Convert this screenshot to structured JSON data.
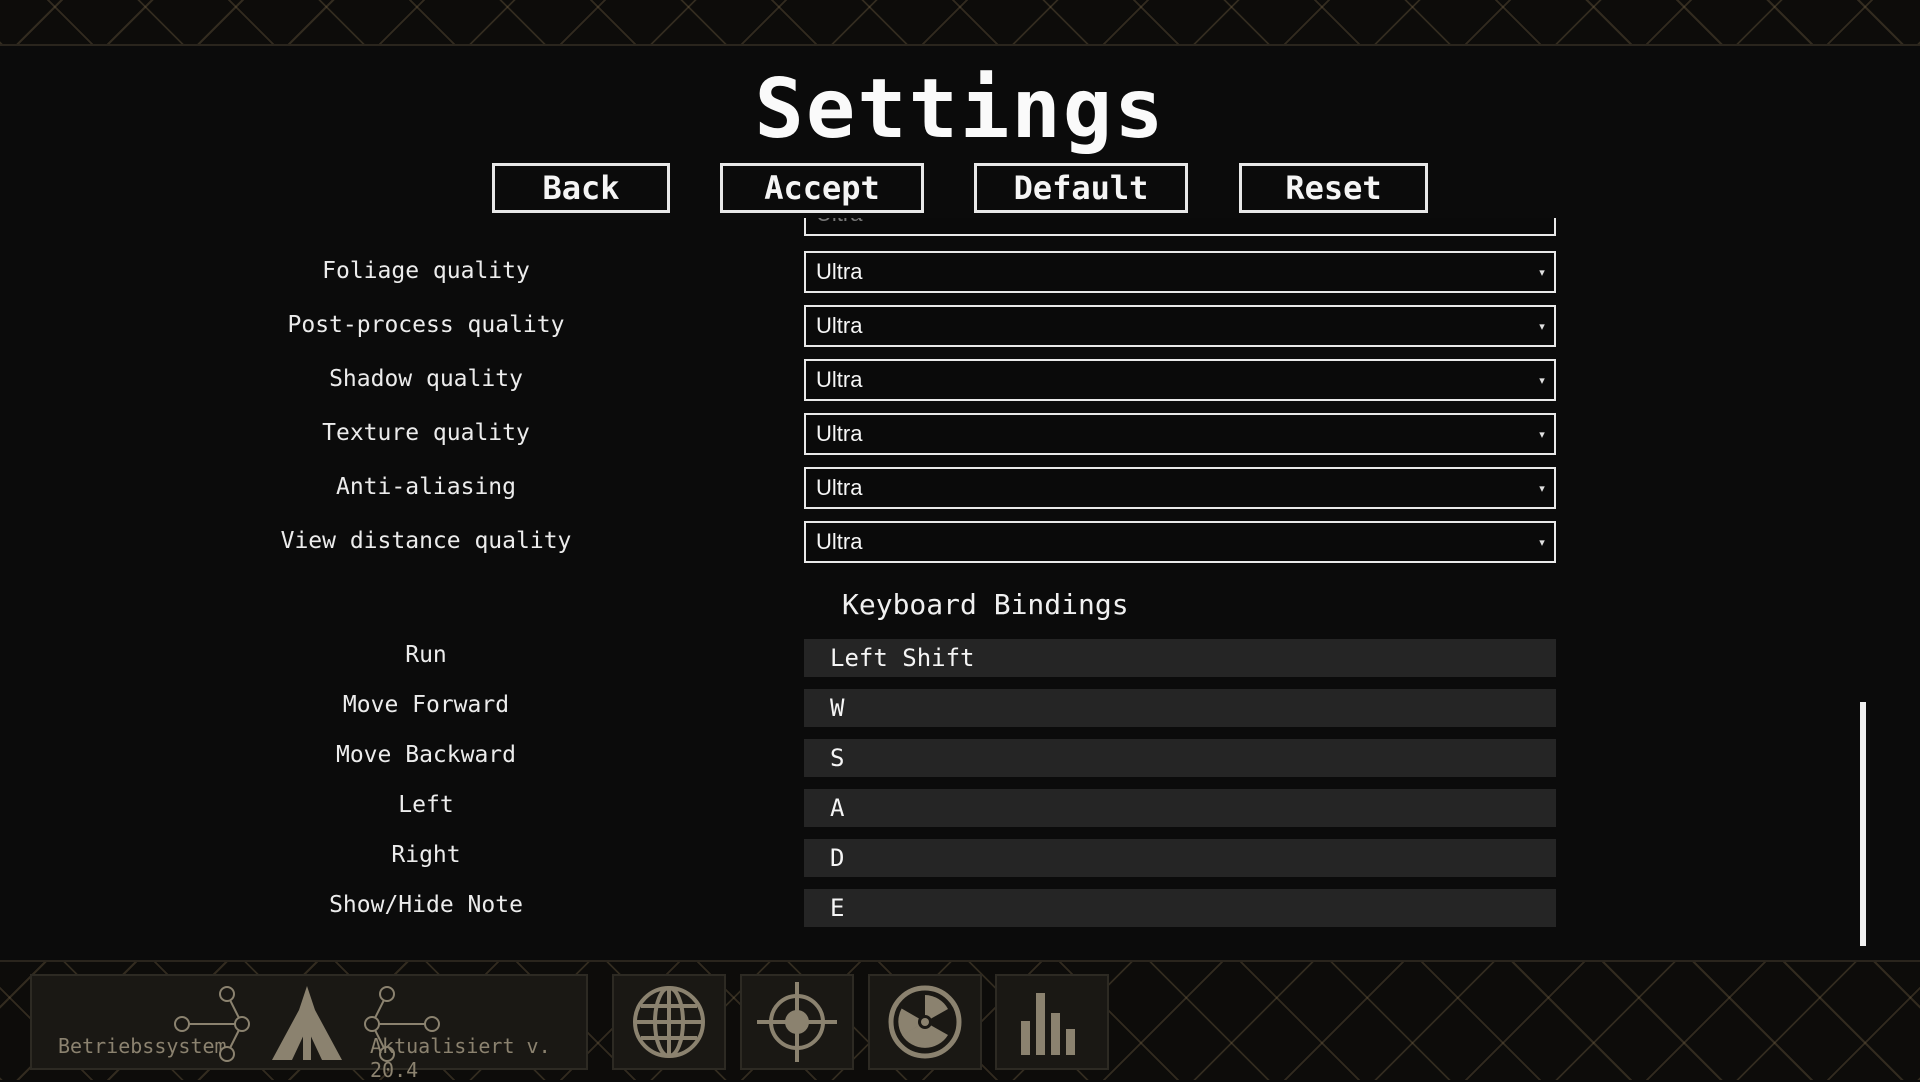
{
  "title": "Settings",
  "buttons": {
    "back": "Back",
    "accept": "Accept",
    "default": "Default",
    "reset": "Reset"
  },
  "graphics": {
    "partial_row_value": "Ultra",
    "rows": [
      {
        "label": "Foliage quality",
        "value": "Ultra"
      },
      {
        "label": "Post-process quality",
        "value": "Ultra"
      },
      {
        "label": "Shadow quality",
        "value": "Ultra"
      },
      {
        "label": "Texture quality",
        "value": "Ultra"
      },
      {
        "label": "Anti-aliasing",
        "value": "Ultra"
      },
      {
        "label": "View distance quality",
        "value": "Ultra"
      }
    ]
  },
  "keyboard": {
    "header": "Keyboard Bindings",
    "bindings": [
      {
        "action": "Run",
        "key": "Left Shift"
      },
      {
        "action": "Move Forward",
        "key": "W"
      },
      {
        "action": "Move Backward",
        "key": "S"
      },
      {
        "action": "Left",
        "key": "A"
      },
      {
        "action": "Right",
        "key": "D"
      },
      {
        "action": "Show/Hide Note",
        "key": "E"
      }
    ]
  },
  "taskbar": {
    "os_label": "Betriebssystem",
    "version_label": "Aktualisiert v. 20.4",
    "icons": [
      "globe-icon",
      "crosshair-icon",
      "radiation-icon",
      "bar-chart-icon"
    ]
  },
  "colors": {
    "accent": "#f2f2f2",
    "muted": "#8b826f",
    "keybox": "#252525",
    "pattern": "#786446"
  }
}
